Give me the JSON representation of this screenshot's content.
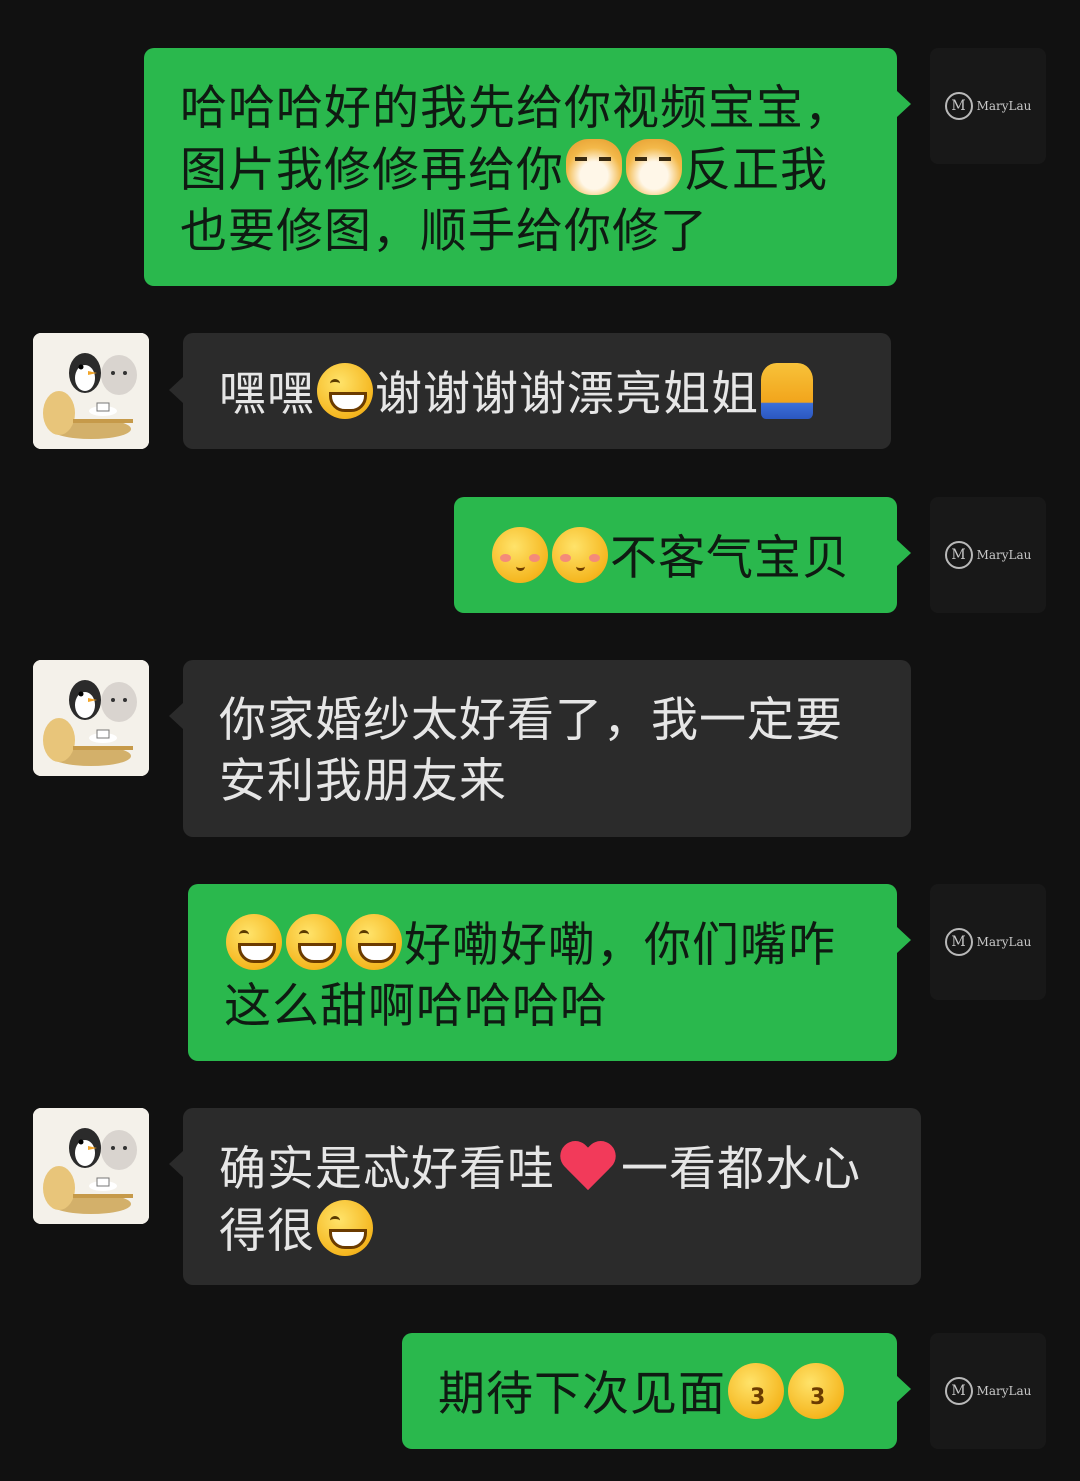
{
  "chat": {
    "self_logo": {
      "name": "MaryLau",
      "mark": "M"
    },
    "other_avatar": "penguin-and-cat-sticker",
    "messages": [
      {
        "sender": "self",
        "parts": [
          {
            "type": "text",
            "value": "哈哈哈好的我先给你视频宝宝，图片我修修再给你"
          },
          {
            "type": "emoji",
            "value": "doge-emoji"
          },
          {
            "type": "emoji",
            "value": "doge-emoji"
          },
          {
            "type": "text",
            "value": "反正我也要修图，顺手给你修了"
          }
        ]
      },
      {
        "sender": "other",
        "parts": [
          {
            "type": "text",
            "value": "嘿嘿"
          },
          {
            "type": "emoji",
            "value": "grin-emoji"
          },
          {
            "type": "text",
            "value": "谢谢谢谢漂亮姐姐"
          },
          {
            "type": "emoji",
            "value": "pray-emoji"
          }
        ]
      },
      {
        "sender": "self",
        "parts": [
          {
            "type": "emoji",
            "value": "shy-emoji"
          },
          {
            "type": "emoji",
            "value": "shy-emoji"
          },
          {
            "type": "text",
            "value": "不客气宝贝"
          }
        ]
      },
      {
        "sender": "other",
        "parts": [
          {
            "type": "text",
            "value": "你家婚纱太好看了，我一定要安利我朋友来"
          }
        ]
      },
      {
        "sender": "self",
        "parts": [
          {
            "type": "emoji",
            "value": "grin-emoji"
          },
          {
            "type": "emoji",
            "value": "grin-emoji"
          },
          {
            "type": "emoji",
            "value": "grin-emoji"
          },
          {
            "type": "text",
            "value": "好嘞好嘞，你们嘴咋这么甜啊哈哈哈哈"
          }
        ]
      },
      {
        "sender": "other",
        "parts": [
          {
            "type": "text",
            "value": "确实是忒好看哇"
          },
          {
            "type": "emoji",
            "value": "heart-emoji"
          },
          {
            "type": "text",
            "value": "一看都水心得很"
          },
          {
            "type": "emoji",
            "value": "grin-emoji"
          }
        ]
      },
      {
        "sender": "self",
        "parts": [
          {
            "type": "text",
            "value": "期待下次见面"
          },
          {
            "type": "emoji",
            "value": "kiss-emoji"
          },
          {
            "type": "emoji",
            "value": "kiss-emoji"
          }
        ]
      }
    ]
  }
}
